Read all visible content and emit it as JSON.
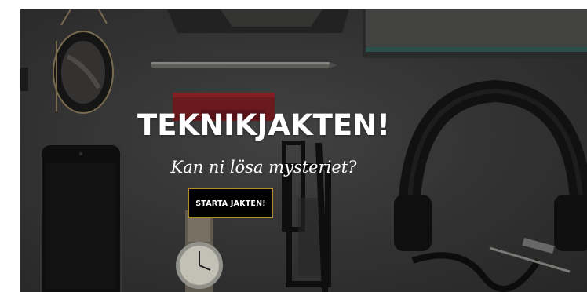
{
  "hero": {
    "title": "TEKNIKJAKTEN!",
    "subtitle": "Kan ni lösa mysteriet?",
    "cta_label": "STARTA JAKTEN!"
  },
  "colors": {
    "background_dark": "#3a3a3a",
    "button_bg": "#000000",
    "button_border": "#b58a2a",
    "text": "#ffffff"
  },
  "icons": [
    "sunglasses",
    "pen",
    "smartphone",
    "wristwatch",
    "eyeglasses",
    "headphones",
    "notebook",
    "wallet"
  ]
}
